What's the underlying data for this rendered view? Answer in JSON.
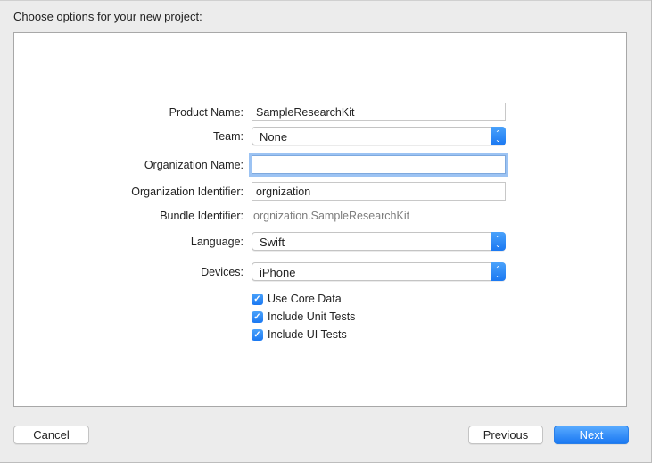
{
  "dialog": {
    "heading": "Choose options for your new project:",
    "fields": {
      "product_name": {
        "label": "Product Name:",
        "value": "SampleResearchKit"
      },
      "team": {
        "label": "Team:",
        "value": "None"
      },
      "organization_name": {
        "label": "Organization Name:",
        "value": ""
      },
      "organization_identifier": {
        "label": "Organization Identifier:",
        "value": "orgnization"
      },
      "bundle_identifier": {
        "label": "Bundle Identifier:",
        "value": "orgnization.SampleResearchKit"
      },
      "language": {
        "label": "Language:",
        "value": "Swift"
      },
      "devices": {
        "label": "Devices:",
        "value": "iPhone"
      }
    },
    "checkboxes": [
      {
        "label": "Use Core Data",
        "checked": true
      },
      {
        "label": "Include Unit Tests",
        "checked": true
      },
      {
        "label": "Include UI Tests",
        "checked": true
      }
    ],
    "buttons": {
      "cancel": "Cancel",
      "previous": "Previous",
      "next": "Next"
    },
    "icons": {
      "stepper": "up-down-chevron",
      "checkmark": "✓"
    },
    "colors": {
      "accent": "#1a78f2",
      "focus_ring": "#9cc3f3"
    }
  }
}
